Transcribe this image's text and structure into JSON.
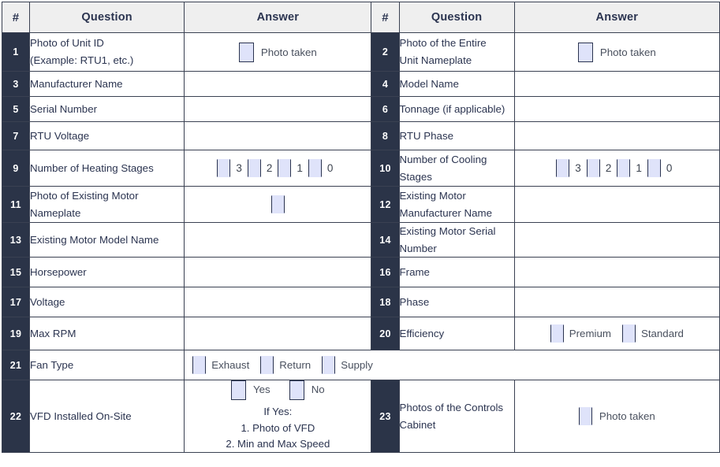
{
  "meta": {
    "colors": {
      "header_bg": "#efefef",
      "num_bg": "#2b3448",
      "text": "#2b3450",
      "checkbox_fill": "#dfe3fa",
      "border": "#3a4152"
    }
  },
  "headers": {
    "num": "#",
    "question": "Question",
    "answer": "Answer"
  },
  "labels": {
    "photo_taken": "Photo taken",
    "premium": "Premium",
    "standard": "Standard",
    "exhaust": "Exhaust",
    "return": "Return",
    "supply": "Supply",
    "yes": "Yes",
    "no": "No",
    "if_yes": "If Yes:",
    "vfd_item_1": "1. Photo of VFD",
    "vfd_item_2": "2. Min and Max Speed",
    "stage_3": "3",
    "stage_2": "2",
    "stage_1": "1",
    "stage_0": "0"
  },
  "rows": [
    {
      "left": {
        "num": "1",
        "q_line1": "Photo of Unit ID",
        "q_line2": "(Example: RTU1, etc.)"
      },
      "right": {
        "num": "2",
        "q_line1": "Photo of the Entire",
        "q_line2": "Unit Nameplate"
      }
    },
    {
      "left": {
        "num": "3",
        "q_line1": "Manufacturer Name",
        "q_line2": ""
      },
      "right": {
        "num": "4",
        "q_line1": "Model Name",
        "q_line2": ""
      }
    },
    {
      "left": {
        "num": "5",
        "q_line1": "Serial Number",
        "q_line2": ""
      },
      "right": {
        "num": "6",
        "q_line1": "Tonnage (if applicable)",
        "q_line2": ""
      }
    },
    {
      "left": {
        "num": "7",
        "q_line1": "RTU Voltage",
        "q_line2": ""
      },
      "right": {
        "num": "8",
        "q_line1": "RTU Phase",
        "q_line2": ""
      }
    },
    {
      "left": {
        "num": "9",
        "q_line1": "Number of Heating Stages",
        "q_line2": ""
      },
      "right": {
        "num": "10",
        "q_line1": "Number of Cooling",
        "q_line2": "Stages"
      }
    },
    {
      "left": {
        "num": "11",
        "q_line1": "Photo of Existing Motor",
        "q_line2": "Nameplate"
      },
      "right": {
        "num": "12",
        "q_line1": "Existing Motor",
        "q_line2": "Manufacturer Name"
      }
    },
    {
      "left": {
        "num": "13",
        "q_line1": "Existing Motor Model Name",
        "q_line2": ""
      },
      "right": {
        "num": "14",
        "q_line1": "Existing Motor Serial",
        "q_line2": "Number"
      }
    },
    {
      "left": {
        "num": "15",
        "q_line1": "Horsepower",
        "q_line2": ""
      },
      "right": {
        "num": "16",
        "q_line1": "Frame",
        "q_line2": ""
      }
    },
    {
      "left": {
        "num": "17",
        "q_line1": "Voltage",
        "q_line2": ""
      },
      "right": {
        "num": "18",
        "q_line1": "Phase",
        "q_line2": ""
      }
    },
    {
      "left": {
        "num": "19",
        "q_line1": "Max RPM",
        "q_line2": ""
      },
      "right": {
        "num": "20",
        "q_line1": "Efficiency",
        "q_line2": ""
      }
    },
    {
      "left": {
        "num": "21",
        "q_line1": "Fan Type",
        "q_line2": ""
      },
      "right": null
    },
    {
      "left": {
        "num": "22",
        "q_line1": "VFD Installed On-Site",
        "q_line2": ""
      },
      "right": {
        "num": "23",
        "q_line1": "Photos of the Controls",
        "q_line2": "Cabinet"
      }
    }
  ]
}
